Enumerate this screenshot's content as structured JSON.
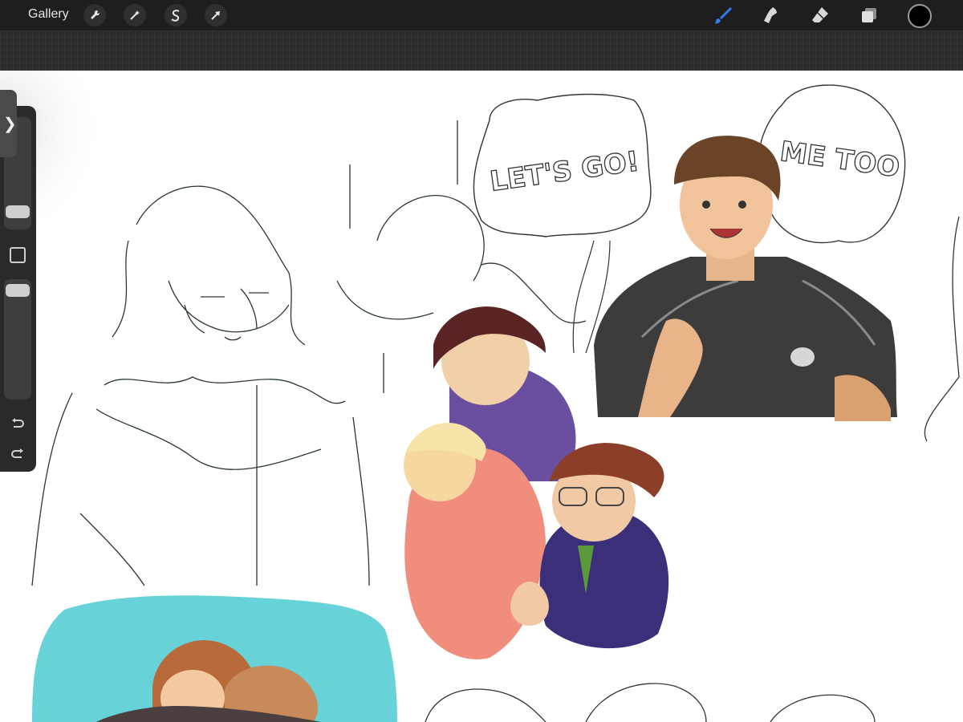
{
  "toolbar": {
    "gallery_label": "Gallery",
    "left_tools": [
      "wrench-icon",
      "magic-wand-icon",
      "selection-icon",
      "move-arrow-icon"
    ],
    "right_tools": [
      "brush-icon",
      "smudge-icon",
      "eraser-icon",
      "layers-icon",
      "color-swatch"
    ],
    "active_tool": "brush",
    "active_color": "#000000",
    "brush_accent": "#2f7cf6"
  },
  "sidebar": {
    "brush_size_level": 0.12,
    "opacity_level": 0.06,
    "controls": [
      "collapse-tab",
      "brush-size-slider",
      "modify-button",
      "opacity-slider",
      "undo-button",
      "redo-button"
    ]
  },
  "canvas": {
    "speech_bubble_1": "LET'S GO!",
    "speech_bubble_2": "ME TOO"
  }
}
